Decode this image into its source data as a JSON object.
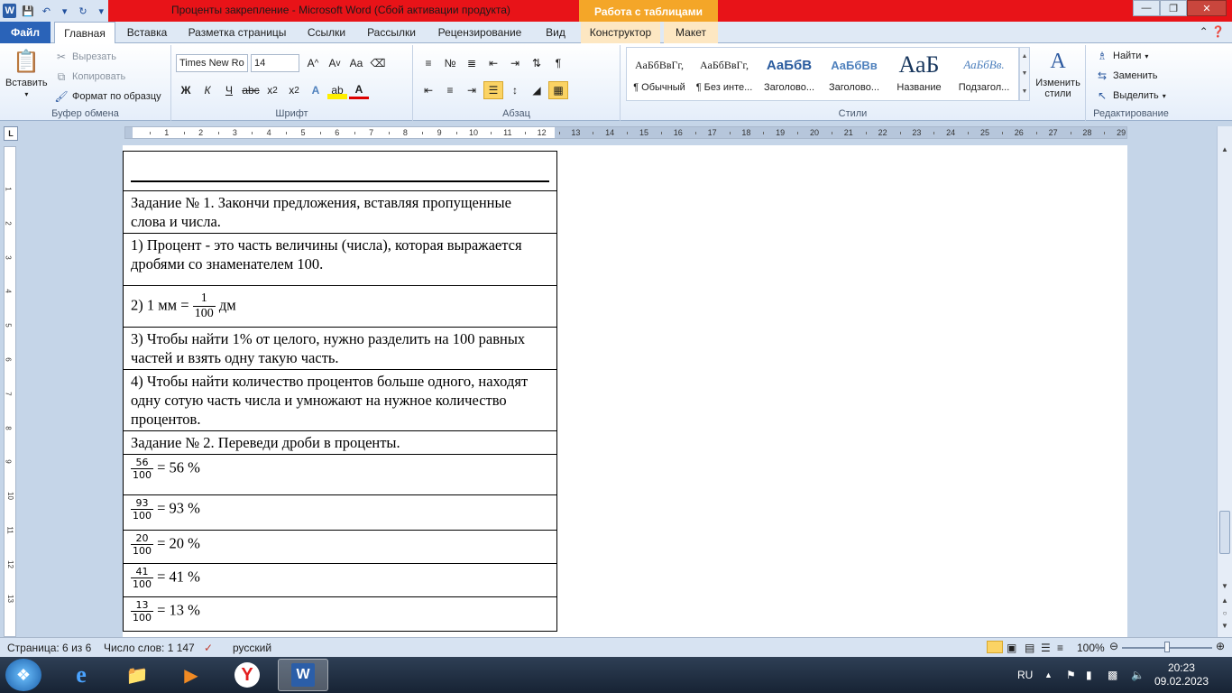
{
  "window": {
    "title": "Проценты закрепление  -  Microsoft Word (Сбой активации продукта)",
    "table_tools": "Работа с таблицами"
  },
  "tabs": [
    {
      "label": "Файл"
    },
    {
      "label": "Главная"
    },
    {
      "label": "Вставка"
    },
    {
      "label": "Разметка страницы"
    },
    {
      "label": "Ссылки"
    },
    {
      "label": "Рассылки"
    },
    {
      "label": "Рецензирование"
    },
    {
      "label": "Вид"
    },
    {
      "label": "Конструктор"
    },
    {
      "label": "Макет"
    }
  ],
  "ribbon": {
    "clipboard": {
      "label": "Буфер обмена",
      "paste": "Вставить",
      "cut": "Вырезать",
      "copy": "Копировать",
      "format_painter": "Формат по образцу"
    },
    "font": {
      "label": "Шрифт",
      "font_name": "Times New Ro",
      "font_size": "14"
    },
    "paragraph": {
      "label": "Абзац"
    },
    "styles": {
      "label": "Стили",
      "items": [
        {
          "sample": "АаБбВвГг,",
          "name": "¶ Обычный"
        },
        {
          "sample": "АаБбВвГг,",
          "name": "¶ Без инте..."
        },
        {
          "sample": "АаБбВ",
          "name": "Заголово..."
        },
        {
          "sample": "АаБбВв",
          "name": "Заголово..."
        },
        {
          "sample": "АаБ",
          "name": "Название"
        },
        {
          "sample": "АаБбВв.",
          "name": "Подзагол..."
        }
      ],
      "change_styles": "Изменить стили"
    },
    "editing": {
      "label": "Редактирование",
      "find": "Найти",
      "replace": "Заменить",
      "select": "Выделить"
    }
  },
  "ruler": {
    "marks": [
      "1",
      "2",
      "3",
      "4",
      "5",
      "6",
      "7",
      "8",
      "9",
      "10",
      "11",
      "12",
      "13",
      "14",
      "15",
      "16",
      "17",
      "18",
      "19",
      "20",
      "21",
      "22",
      "23",
      "24",
      "25",
      "26",
      "27",
      "28",
      "29"
    ],
    "vmarks": [
      "1",
      "2",
      "3",
      "4",
      "5",
      "6",
      "7",
      "8",
      "9",
      "10",
      "11",
      "12",
      "13"
    ]
  },
  "document": {
    "rows": [
      {
        "text": "Задание № 1. Закончи предложения, вставляя пропущенные слова и числа."
      },
      {
        "text": "1) Процент  - это часть величины (числа), которая выражается дробями со знаменателем 100."
      },
      {
        "prefix": "2) 1 мм = ",
        "num": "1",
        "den": "100",
        "suffix": " дм"
      },
      {
        "text": "3) Чтобы найти 1% от целого, нужно разделить на 100 равных частей и взять одну такую часть."
      },
      {
        "text": "4) Чтобы найти количество процентов больше одного, находят одну сотую часть числа и умножают на нужное количество процентов."
      },
      {
        "text": "Задание № 2. Переведи дроби в проценты."
      }
    ],
    "fractions": [
      {
        "num": "56",
        "den": "100",
        "result": " = 56 %"
      },
      {
        "num": "93",
        "den": "100",
        "result": " = 93 %"
      },
      {
        "num": "20",
        "den": "100",
        "result": " = 20 %"
      },
      {
        "num": "41",
        "den": "100",
        "result": " = 41 %"
      },
      {
        "num": "13",
        "den": "100",
        "result": " = 13 %"
      }
    ]
  },
  "statusbar": {
    "page": "Страница: 6 из 6",
    "words": "Число слов: 1 147",
    "language": "русский",
    "zoom": "100%",
    "zoom_level": 1.0
  },
  "taskbar": {
    "lang": "RU",
    "time": "20:23",
    "date": "09.02.2023"
  },
  "colors": {
    "titlebar": "#e81318",
    "file_tab": "#2a63b8",
    "table_tools": "#f4a628"
  }
}
